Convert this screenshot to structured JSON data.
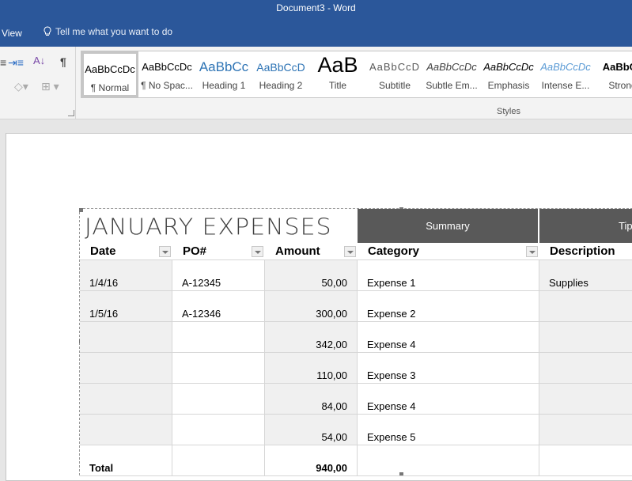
{
  "window": {
    "title": "Document3  -  Word"
  },
  "menubar": {
    "view_tab": "View",
    "tell_me": "Tell me what you want to do"
  },
  "ribbon": {
    "styles_group_label": "Styles",
    "styles": [
      {
        "sample": "AaBbCcDc",
        "label": "¶ Normal",
        "color": "#000000",
        "selected": true
      },
      {
        "sample": "AaBbCcDc",
        "label": "¶ No Spac...",
        "color": "#000000"
      },
      {
        "sample": "AaBbCc",
        "label": "Heading 1",
        "color": "#2e74b5"
      },
      {
        "sample": "AaBbCcD",
        "label": "Heading 2",
        "color": "#2e74b5"
      },
      {
        "sample": "AaB",
        "label": "Title",
        "color": "#000000"
      },
      {
        "sample": "AaBbCcD",
        "label": "Subtitle",
        "color": "#595959"
      },
      {
        "sample": "AaBbCcDc",
        "label": "Subtle Em...",
        "color": "#404040"
      },
      {
        "sample": "AaBbCcDc",
        "label": "Emphasis",
        "color": "#000000"
      },
      {
        "sample": "AaBbCcDc",
        "label": "Intense E...",
        "color": "#5b9bd5"
      },
      {
        "sample": "AaBbCc",
        "label": "Strong",
        "color": "#000000"
      }
    ]
  },
  "document": {
    "title": "JANUARY EXPENSES",
    "summary_banner": "Summary",
    "tips_banner": "Tip",
    "columns": [
      "Date",
      "PO#",
      "Amount",
      "Category",
      "Description"
    ],
    "rows": [
      {
        "date": "1/4/16",
        "po": "A-12345",
        "amount": "50,00",
        "category": "Expense 1",
        "description": "Supplies"
      },
      {
        "date": "1/5/16",
        "po": "A-12346",
        "amount": "300,00",
        "category": "Expense 2",
        "description": ""
      },
      {
        "date": "",
        "po": "",
        "amount": "342,00",
        "category": "Expense 4",
        "description": ""
      },
      {
        "date": "",
        "po": "",
        "amount": "110,00",
        "category": "Expense 3",
        "description": ""
      },
      {
        "date": "",
        "po": "",
        "amount": "84,00",
        "category": "Expense 4",
        "description": ""
      },
      {
        "date": "",
        "po": "",
        "amount": "54,00",
        "category": "Expense 5",
        "description": ""
      }
    ],
    "total_label": "Total",
    "total_amount": "940,00"
  }
}
